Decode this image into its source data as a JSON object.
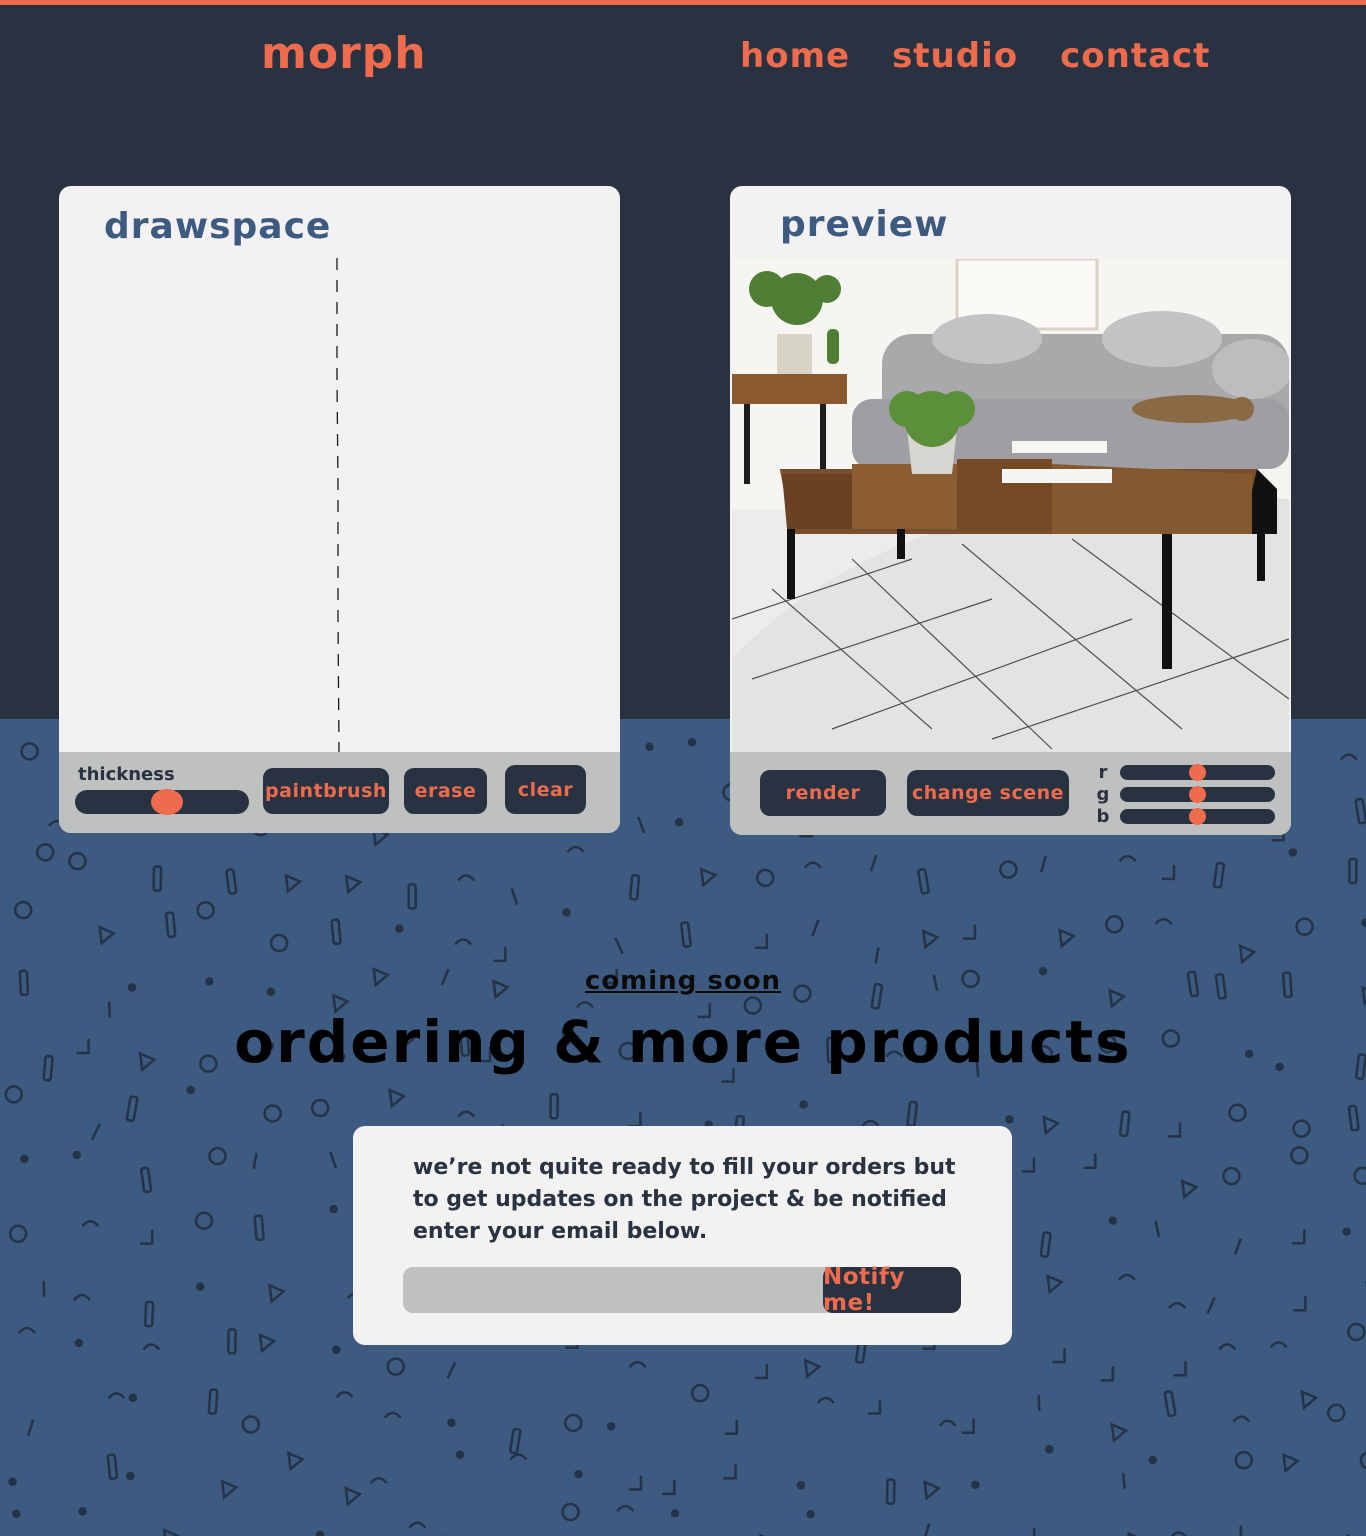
{
  "header": {
    "logo": "morph",
    "nav": [
      "home",
      "studio",
      "contact"
    ]
  },
  "drawspace": {
    "title": "drawspace",
    "thickness_label": "thickness",
    "thickness_level": 0.52,
    "buttons": {
      "paintbrush": "paintbrush",
      "erase": "erase",
      "clear": "clear"
    }
  },
  "preview": {
    "title": "preview",
    "buttons": {
      "render": "render",
      "change_scene": "change scene"
    },
    "rgb": [
      {
        "label": "r",
        "level": 0.5
      },
      {
        "label": "g",
        "level": 0.5
      },
      {
        "label": "b",
        "level": 0.5
      }
    ]
  },
  "coming_soon": {
    "kicker": "coming soon",
    "headline": "ordering & more products"
  },
  "signup": {
    "text": "we’re not quite ready to fill your orders but to get updates on the project & be notified enter your email below.",
    "email_value": "",
    "email_placeholder": "",
    "button": "Notify me!"
  },
  "colors": {
    "dark": "#293241",
    "accent": "#ee6c4d",
    "blue": "#3d5a80",
    "panel": "#f3f1f2",
    "toolbar": "#bfc0c0"
  }
}
